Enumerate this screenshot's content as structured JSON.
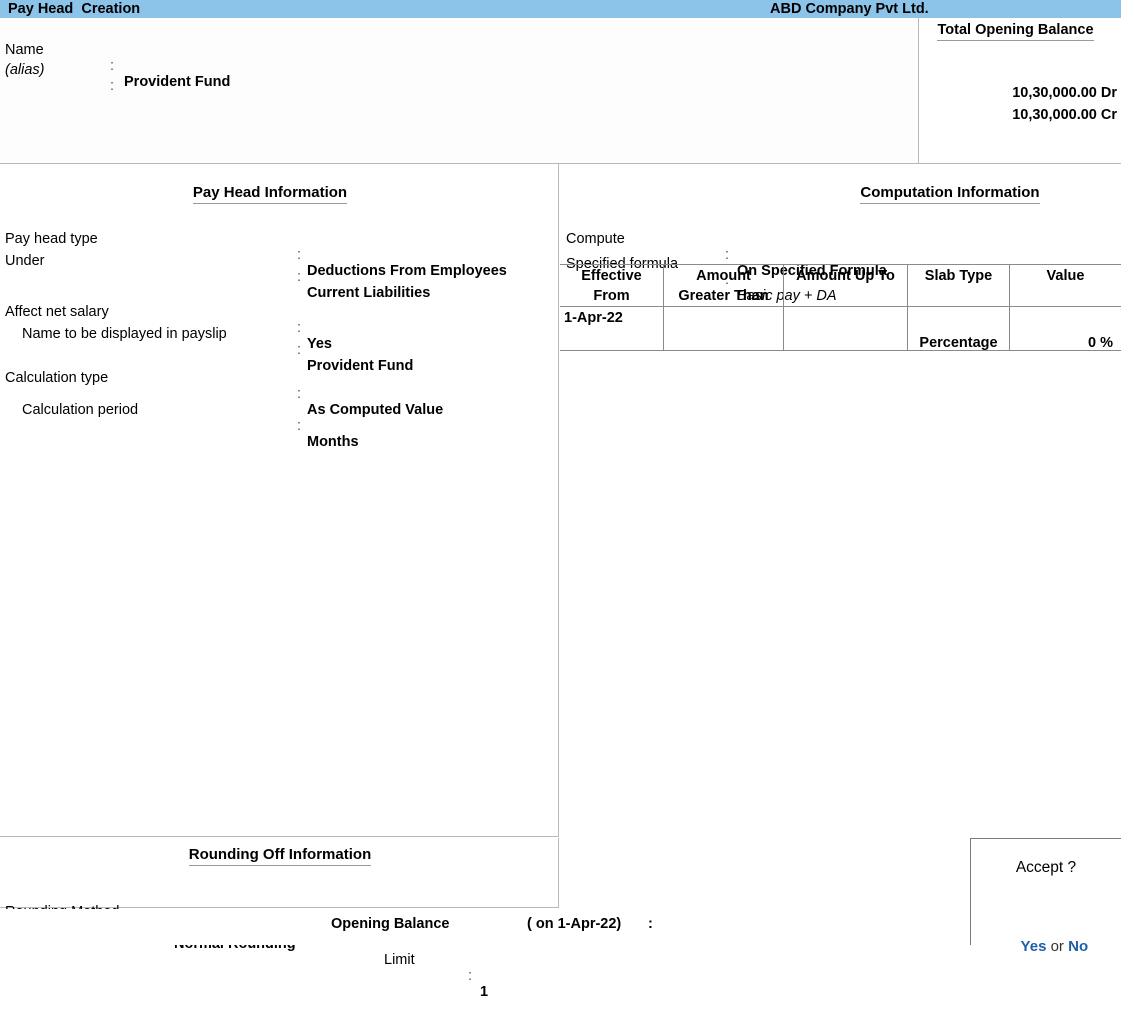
{
  "titlebar": {
    "screen_title": "Pay Head  Creation",
    "company_name": "ABD Company Pvt Ltd."
  },
  "header_form": {
    "name_label": "Name",
    "name_colon": ":",
    "name_value": "Provident Fund",
    "alias_label": "(alias)",
    "alias_colon": ":",
    "alias_value": ""
  },
  "total_opening_balance": {
    "title": "Total Opening Balance",
    "debit": "10,30,000.00 Dr",
    "credit": "10,30,000.00 Cr"
  },
  "pay_head_information": {
    "title": "Pay Head Information",
    "fields": [
      {
        "label": "Pay head type",
        "colon": ":",
        "value": "Deductions From Employees",
        "indent": false
      },
      {
        "label": "Under",
        "colon": ":",
        "value": "Current Liabilities",
        "indent": false
      },
      {
        "label": "Affect net salary",
        "colon": ":",
        "value": "Yes",
        "indent": false
      },
      {
        "label": "Name to be displayed in payslip",
        "colon": ":",
        "value": "Provident Fund",
        "indent": true
      },
      {
        "label": "Calculation type",
        "colon": ":",
        "value": "As Computed Value",
        "indent": false
      },
      {
        "label": "Calculation period",
        "colon": ":",
        "value": "Months",
        "indent": true
      }
    ]
  },
  "computation_information": {
    "title": "Computation Information",
    "fields": [
      {
        "label": "Compute",
        "colon": ":",
        "value": "On Specified Formula"
      },
      {
        "label": "Specified formula",
        "colon": ":",
        "value": "Basic pay + DA"
      }
    ],
    "slab_table": {
      "columns": [
        {
          "line1": "Effective",
          "line2": "From"
        },
        {
          "line1": "Amount",
          "line2": "Greater Than"
        },
        {
          "line1": "Amount Up To",
          "line2": ""
        },
        {
          "line1": "Slab Type",
          "line2": ""
        },
        {
          "line1": "Value",
          "line2": ""
        }
      ],
      "rows": [
        {
          "effective_from": "1-Apr-22",
          "amount_greater_than": "",
          "amount_up_to": "",
          "slab_type": "Percentage",
          "value": "0 %"
        }
      ]
    }
  },
  "rounding_off_information": {
    "title": "Rounding Off Information",
    "method_label": "Rounding Method",
    "method_colon": ":",
    "method_value": "Normal Rounding",
    "limit_label": "Limit",
    "limit_colon": ":",
    "limit_value": "1"
  },
  "opening_balance_footer": {
    "label": "Opening Balance",
    "date": "( on 1-Apr-22)",
    "colon": ":"
  },
  "accept_dialog": {
    "prompt": "Accept ?",
    "yes_label": "Yes",
    "or_label": " or ",
    "no_label": "No"
  },
  "colors": {
    "title_bar": "#8cc3e9",
    "link_blue": "#1f5fa9",
    "border_grey": "#8a8a8a",
    "panel_bg": "#ffffff"
  }
}
